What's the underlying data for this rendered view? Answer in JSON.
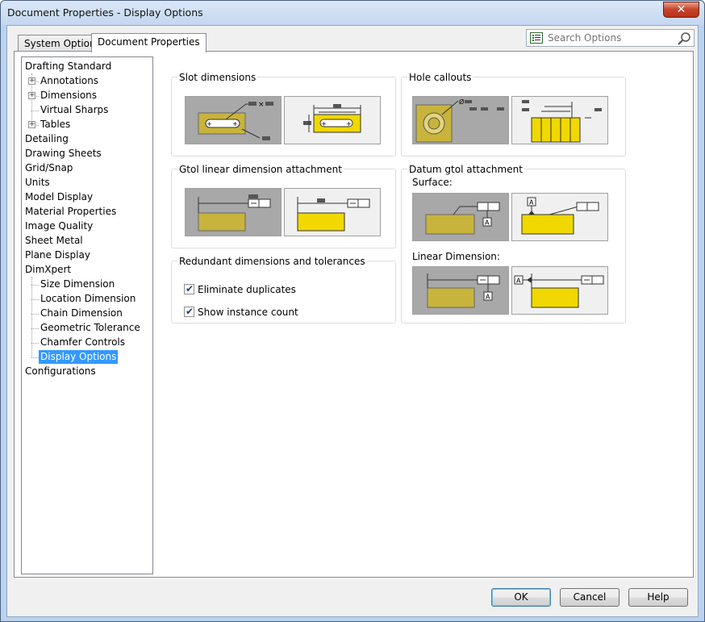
{
  "window": {
    "title": "Document Properties - Display Options",
    "close_glyph": "✕"
  },
  "tabs": [
    {
      "label": "System Options"
    },
    {
      "label": "Document Properties"
    }
  ],
  "search": {
    "placeholder": "Search Options",
    "value": ""
  },
  "tree": {
    "items": [
      {
        "label": "Drafting Standard"
      },
      {
        "label": "Annotations",
        "expander": "+"
      },
      {
        "label": "Dimensions",
        "expander": "+"
      },
      {
        "label": "Virtual Sharps"
      },
      {
        "label": "Tables",
        "expander": "+"
      },
      {
        "label": "Detailing"
      },
      {
        "label": "Drawing Sheets"
      },
      {
        "label": "Grid/Snap"
      },
      {
        "label": "Units"
      },
      {
        "label": "Model Display"
      },
      {
        "label": "Material Properties"
      },
      {
        "label": "Image Quality"
      },
      {
        "label": "Sheet Metal"
      },
      {
        "label": "Plane Display"
      },
      {
        "label": "DimXpert"
      },
      {
        "label": "Size Dimension"
      },
      {
        "label": "Location Dimension"
      },
      {
        "label": "Chain Dimension"
      },
      {
        "label": "Geometric Tolerance"
      },
      {
        "label": "Chamfer Controls"
      },
      {
        "label": "Display Options",
        "selected": true
      },
      {
        "label": "Configurations"
      }
    ]
  },
  "groups": {
    "slot": {
      "label": "Slot dimensions"
    },
    "hole": {
      "label": "Hole callouts"
    },
    "gtol": {
      "label": "Gtol linear dimension attachment"
    },
    "datum": {
      "label": "Datum gtol attachment",
      "surface_label": "Surface:",
      "linear_label": "Linear Dimension:"
    },
    "redundant": {
      "label": "Redundant dimensions and tolerances",
      "options": [
        {
          "label": "Eliminate duplicates",
          "checked": true
        },
        {
          "label": "Show instance count",
          "checked": true
        }
      ]
    }
  },
  "diagram_text": {
    "datum_letter": "A",
    "diameter": "Ø",
    "times": "×"
  },
  "buttons": {
    "ok": "OK",
    "cancel": "Cancel",
    "help": "Help"
  },
  "colors": {
    "selection": "#3399ff",
    "part_fill": "#f0d800",
    "part_fill_dark": "#c8b43c"
  }
}
